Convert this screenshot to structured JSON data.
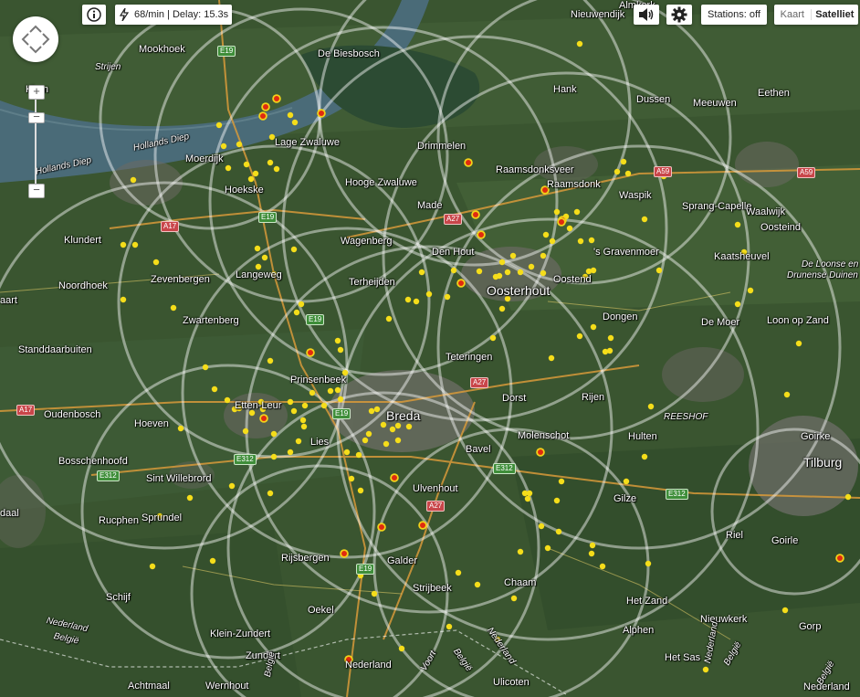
{
  "toolbar": {
    "info_icon": "info-icon",
    "rate_text": "68/min | Delay: 15.3s",
    "sound_icon": "speaker-icon",
    "settings_icon": "gear-icon",
    "stations_label": "Stations: off",
    "map_type_map": "Kaart",
    "map_type_satellite": "Satelliet"
  },
  "map": {
    "places": [
      {
        "t": "Mookhoek"
      },
      {
        "t": "Strijen"
      },
      {
        "t": "De Biesbosch"
      },
      {
        "t": "Nieuwendijk"
      },
      {
        "t": "Almkerk"
      },
      {
        "t": "Klem"
      },
      {
        "t": "Hollands Diep"
      },
      {
        "t": "Hollands Diep"
      },
      {
        "t": "Moerdijk"
      },
      {
        "t": "Lage Zwaluwe"
      },
      {
        "t": "Drimmelen"
      },
      {
        "t": "Hank"
      },
      {
        "t": "Dussen"
      },
      {
        "t": "Meeuwen"
      },
      {
        "t": "Eethen"
      },
      {
        "t": "Raamsdonksveer"
      },
      {
        "t": "Raamsdonk"
      },
      {
        "t": "Waspik"
      },
      {
        "t": "Hooge Zwaluwe"
      },
      {
        "t": "Hoekske"
      },
      {
        "t": "Made"
      },
      {
        "t": "Sprang-Capelle"
      },
      {
        "t": "Waalwijk"
      },
      {
        "t": "Klundert"
      },
      {
        "t": "Wagenberg"
      },
      {
        "t": "Oosteind"
      },
      {
        "t": "Den Hout"
      },
      {
        "t": "'s Gravenmoer"
      },
      {
        "t": "Kaatsheuvel"
      },
      {
        "t": "Zevenbergen"
      },
      {
        "t": "Langeweg"
      },
      {
        "t": "Terheijden"
      },
      {
        "t": "Oostend"
      },
      {
        "t": "De Loonse en"
      },
      {
        "t": "Drunense Duinen"
      },
      {
        "t": "Noordhoek"
      },
      {
        "t": "Oosterhout"
      },
      {
        "t": "aart"
      },
      {
        "t": "Zwartenberg"
      },
      {
        "t": "Dongen"
      },
      {
        "t": "De Moer"
      },
      {
        "t": "Loon op Zand"
      },
      {
        "t": "Standdaarbuiten"
      },
      {
        "t": "Teteringen"
      },
      {
        "t": "Prinsenbeek"
      },
      {
        "t": "Oudenbosch"
      },
      {
        "t": "Etten-Leur"
      },
      {
        "t": "Breda"
      },
      {
        "t": "Dorst"
      },
      {
        "t": "Rijen"
      },
      {
        "t": "REESHOF"
      },
      {
        "t": "Hoeven"
      },
      {
        "t": "Lies"
      },
      {
        "t": "Molenschot"
      },
      {
        "t": "Hulten"
      },
      {
        "t": "Goirke"
      },
      {
        "t": "Bosschenhoofd"
      },
      {
        "t": "Bavel"
      },
      {
        "t": "Tilburg"
      },
      {
        "t": "Sint Willebrord"
      },
      {
        "t": "Ulvenhout"
      },
      {
        "t": "Gilze"
      },
      {
        "t": "daal"
      },
      {
        "t": "Rucphen"
      },
      {
        "t": "Sprundel"
      },
      {
        "t": "Riel"
      },
      {
        "t": "Goirle"
      },
      {
        "t": "Rijsbergen"
      },
      {
        "t": "Galder"
      },
      {
        "t": "Strijbeek"
      },
      {
        "t": "Chaam"
      },
      {
        "t": "Schijf"
      },
      {
        "t": "Het Zand"
      },
      {
        "t": "Oekel"
      },
      {
        "t": "Nieuwkerk"
      },
      {
        "t": "Gorp"
      },
      {
        "t": "Nederland"
      },
      {
        "t": "België"
      },
      {
        "t": "Klein-Zundert"
      },
      {
        "t": "Zundert"
      },
      {
        "t": "Alphen"
      },
      {
        "t": "Het Sas"
      },
      {
        "t": "Nederland"
      },
      {
        "t": "België"
      },
      {
        "t": "Achtmaal"
      },
      {
        "t": "Wernhout"
      },
      {
        "t": "Nederland"
      },
      {
        "t": "België"
      },
      {
        "t": "Nederland"
      },
      {
        "t": "België"
      },
      {
        "t": "Voort"
      },
      {
        "t": "Ulicoten"
      },
      {
        "t": "Nederland"
      },
      {
        "t": "België"
      }
    ],
    "shields": [
      "E19",
      "E19",
      "E19",
      "E19",
      "E19",
      "A17",
      "A17",
      "A59",
      "A59",
      "A27",
      "A27",
      "E312",
      "E312",
      "E312",
      "E312",
      "A27"
    ]
  }
}
